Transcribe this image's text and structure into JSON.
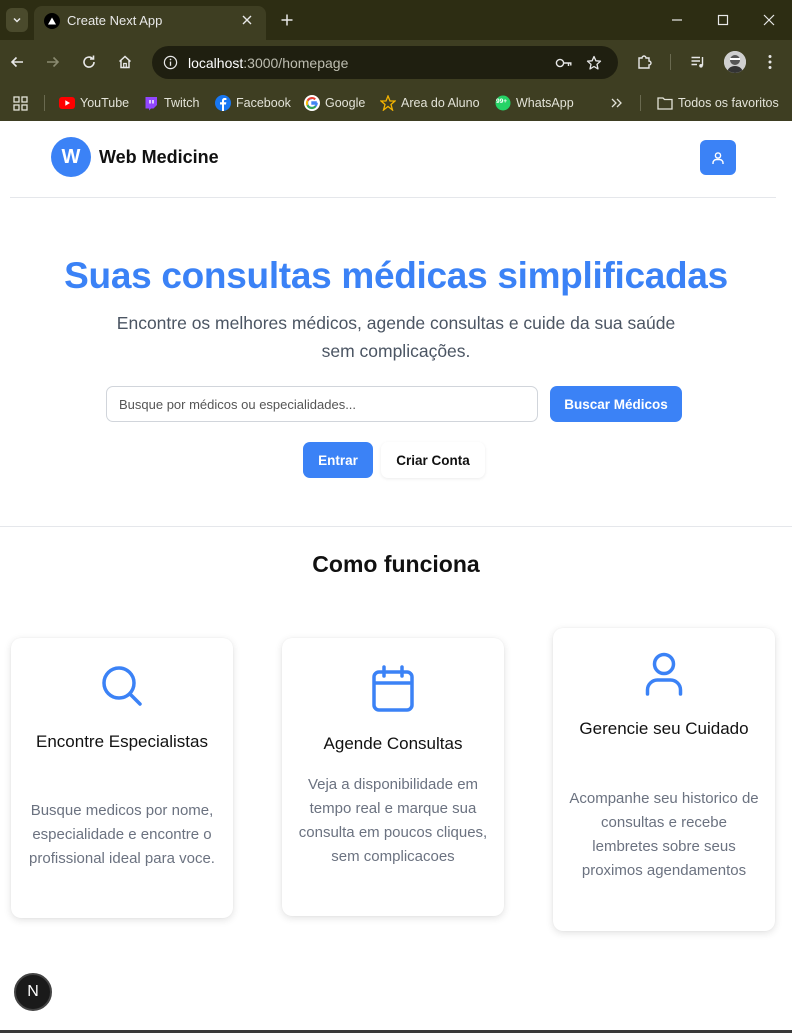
{
  "browser": {
    "tab_title": "Create Next App",
    "url_host": "localhost",
    "url_path": ":3000/homepage",
    "bookmarks": [
      {
        "label": "YouTube",
        "icon": "youtube-icon"
      },
      {
        "label": "Twitch",
        "icon": "twitch-icon"
      },
      {
        "label": "Facebook",
        "icon": "facebook-icon"
      },
      {
        "label": "Google",
        "icon": "google-icon"
      },
      {
        "label": "Area do Aluno",
        "icon": "area-do-aluno-icon"
      },
      {
        "label": "WhatsApp",
        "icon": "whatsapp-icon"
      }
    ],
    "all_favorites": "Todos os favoritos",
    "whatsapp_badge": "99+"
  },
  "header": {
    "logo_letter": "W",
    "brand": "Web Medicine"
  },
  "hero": {
    "title": "Suas consultas médicas simplificadas",
    "subtitle": "Encontre os melhores médicos, agende consultas e cuide da sua saúde sem complicações.",
    "search_placeholder": "Busque por médicos ou especialidades...",
    "search_button": "Buscar Médicos",
    "login_button": "Entrar",
    "signup_button": "Criar Conta"
  },
  "how_it_works": {
    "title": "Como funciona",
    "cards": [
      {
        "icon": "search-icon",
        "title": "Encontre Especialistas",
        "text": "Busque medicos por nome, especialidade e encontre o profissional ideal para voce."
      },
      {
        "icon": "calendar-icon",
        "title": "Agende Consultas",
        "text": "Veja a disponibilidade em tempo real e marque sua consulta em poucos cliques, sem complicacoes"
      },
      {
        "icon": "user-icon",
        "title": "Gerencie seu Cuidado",
        "text": "Acompanhe seu historico de consultas e recebe lembretes sobre seus proximos agendamentos"
      }
    ]
  },
  "dev_badge": "N",
  "colors": {
    "accent": "#3b82f6",
    "chrome_bg": "#3e3e22",
    "tabbar_bg": "#2d2d13"
  }
}
